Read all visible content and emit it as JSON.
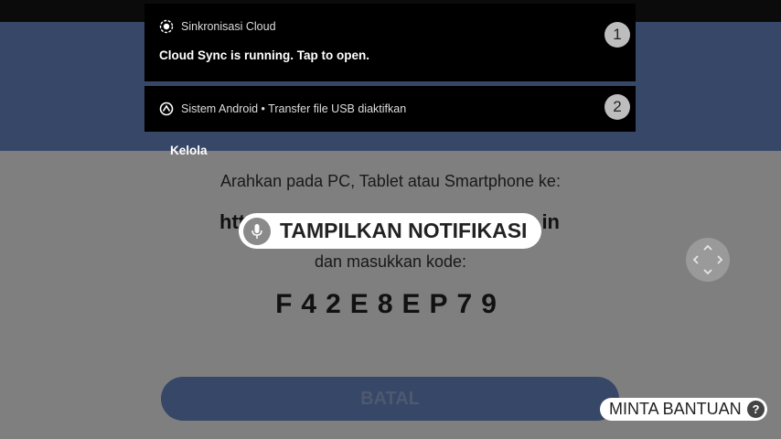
{
  "app": {
    "instruction": "Arahkan pada PC, Tablet atau Smartphone ke:",
    "url_start": "htt",
    "url_end": "in",
    "code_prompt": "dan masukkan kode:",
    "code": "F42E8EP79",
    "cancel_label": "BATAL"
  },
  "notifications": [
    {
      "app": "Sinkronisasi Cloud",
      "title": "Cloud Sync is running. Tap to open.",
      "badge": "1"
    },
    {
      "app": "Sistem Android • Transfer file USB diaktifkan",
      "badge": "2"
    }
  ],
  "manage_label": "Kelola",
  "voice_hint": "TAMPILKAN NOTIFIKASI",
  "help": {
    "label": "MINTA BANTUAN",
    "icon_text": "?"
  },
  "colors": {
    "header": "#6f8ed0",
    "scrim": "rgba(0,0,0,0.5)",
    "notification_bg": "#000000"
  }
}
